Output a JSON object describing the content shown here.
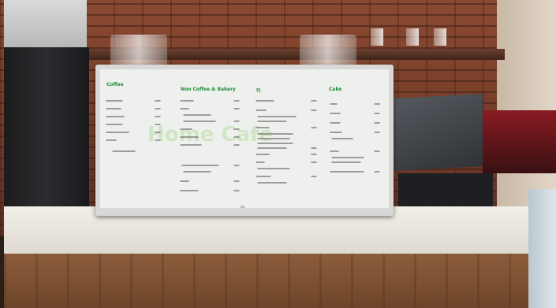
{
  "monitor": {
    "brand_logo": "LG",
    "menu": {
      "header_coffee": "Coffee",
      "header_noncoffee": "Non Coffee & Bakery",
      "header_tea": "티",
      "header_cake": "Cake",
      "watermark": "Home Cafe"
    }
  }
}
